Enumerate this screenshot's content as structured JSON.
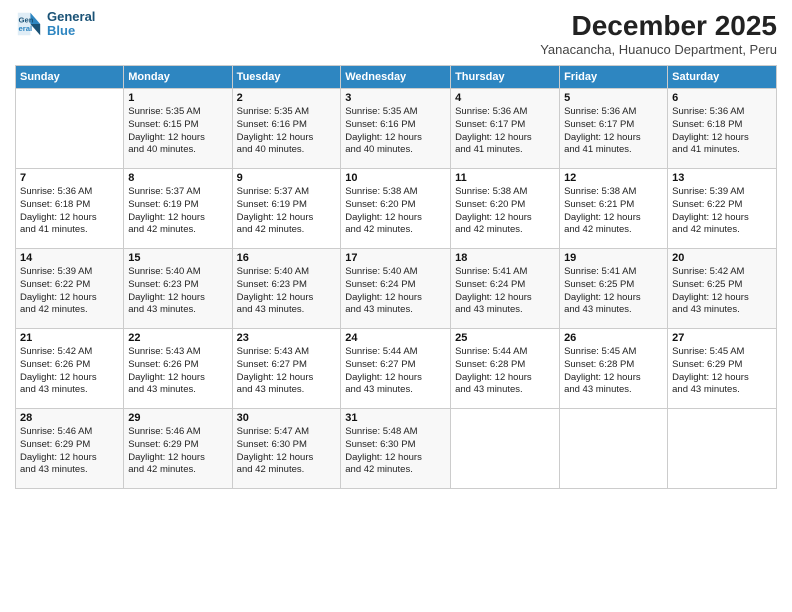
{
  "logo": {
    "line1": "General",
    "line2": "Blue"
  },
  "title": "December 2025",
  "subtitle": "Yanacancha, Huanuco Department, Peru",
  "days_of_week": [
    "Sunday",
    "Monday",
    "Tuesday",
    "Wednesday",
    "Thursday",
    "Friday",
    "Saturday"
  ],
  "weeks": [
    [
      {
        "day": "",
        "info": ""
      },
      {
        "day": "1",
        "info": "Sunrise: 5:35 AM\nSunset: 6:15 PM\nDaylight: 12 hours\nand 40 minutes."
      },
      {
        "day": "2",
        "info": "Sunrise: 5:35 AM\nSunset: 6:16 PM\nDaylight: 12 hours\nand 40 minutes."
      },
      {
        "day": "3",
        "info": "Sunrise: 5:35 AM\nSunset: 6:16 PM\nDaylight: 12 hours\nand 40 minutes."
      },
      {
        "day": "4",
        "info": "Sunrise: 5:36 AM\nSunset: 6:17 PM\nDaylight: 12 hours\nand 41 minutes."
      },
      {
        "day": "5",
        "info": "Sunrise: 5:36 AM\nSunset: 6:17 PM\nDaylight: 12 hours\nand 41 minutes."
      },
      {
        "day": "6",
        "info": "Sunrise: 5:36 AM\nSunset: 6:18 PM\nDaylight: 12 hours\nand 41 minutes."
      }
    ],
    [
      {
        "day": "7",
        "info": "Sunrise: 5:36 AM\nSunset: 6:18 PM\nDaylight: 12 hours\nand 41 minutes."
      },
      {
        "day": "8",
        "info": "Sunrise: 5:37 AM\nSunset: 6:19 PM\nDaylight: 12 hours\nand 42 minutes."
      },
      {
        "day": "9",
        "info": "Sunrise: 5:37 AM\nSunset: 6:19 PM\nDaylight: 12 hours\nand 42 minutes."
      },
      {
        "day": "10",
        "info": "Sunrise: 5:38 AM\nSunset: 6:20 PM\nDaylight: 12 hours\nand 42 minutes."
      },
      {
        "day": "11",
        "info": "Sunrise: 5:38 AM\nSunset: 6:20 PM\nDaylight: 12 hours\nand 42 minutes."
      },
      {
        "day": "12",
        "info": "Sunrise: 5:38 AM\nSunset: 6:21 PM\nDaylight: 12 hours\nand 42 minutes."
      },
      {
        "day": "13",
        "info": "Sunrise: 5:39 AM\nSunset: 6:22 PM\nDaylight: 12 hours\nand 42 minutes."
      }
    ],
    [
      {
        "day": "14",
        "info": "Sunrise: 5:39 AM\nSunset: 6:22 PM\nDaylight: 12 hours\nand 42 minutes."
      },
      {
        "day": "15",
        "info": "Sunrise: 5:40 AM\nSunset: 6:23 PM\nDaylight: 12 hours\nand 43 minutes."
      },
      {
        "day": "16",
        "info": "Sunrise: 5:40 AM\nSunset: 6:23 PM\nDaylight: 12 hours\nand 43 minutes."
      },
      {
        "day": "17",
        "info": "Sunrise: 5:40 AM\nSunset: 6:24 PM\nDaylight: 12 hours\nand 43 minutes."
      },
      {
        "day": "18",
        "info": "Sunrise: 5:41 AM\nSunset: 6:24 PM\nDaylight: 12 hours\nand 43 minutes."
      },
      {
        "day": "19",
        "info": "Sunrise: 5:41 AM\nSunset: 6:25 PM\nDaylight: 12 hours\nand 43 minutes."
      },
      {
        "day": "20",
        "info": "Sunrise: 5:42 AM\nSunset: 6:25 PM\nDaylight: 12 hours\nand 43 minutes."
      }
    ],
    [
      {
        "day": "21",
        "info": "Sunrise: 5:42 AM\nSunset: 6:26 PM\nDaylight: 12 hours\nand 43 minutes."
      },
      {
        "day": "22",
        "info": "Sunrise: 5:43 AM\nSunset: 6:26 PM\nDaylight: 12 hours\nand 43 minutes."
      },
      {
        "day": "23",
        "info": "Sunrise: 5:43 AM\nSunset: 6:27 PM\nDaylight: 12 hours\nand 43 minutes."
      },
      {
        "day": "24",
        "info": "Sunrise: 5:44 AM\nSunset: 6:27 PM\nDaylight: 12 hours\nand 43 minutes."
      },
      {
        "day": "25",
        "info": "Sunrise: 5:44 AM\nSunset: 6:28 PM\nDaylight: 12 hours\nand 43 minutes."
      },
      {
        "day": "26",
        "info": "Sunrise: 5:45 AM\nSunset: 6:28 PM\nDaylight: 12 hours\nand 43 minutes."
      },
      {
        "day": "27",
        "info": "Sunrise: 5:45 AM\nSunset: 6:29 PM\nDaylight: 12 hours\nand 43 minutes."
      }
    ],
    [
      {
        "day": "28",
        "info": "Sunrise: 5:46 AM\nSunset: 6:29 PM\nDaylight: 12 hours\nand 43 minutes."
      },
      {
        "day": "29",
        "info": "Sunrise: 5:46 AM\nSunset: 6:29 PM\nDaylight: 12 hours\nand 42 minutes."
      },
      {
        "day": "30",
        "info": "Sunrise: 5:47 AM\nSunset: 6:30 PM\nDaylight: 12 hours\nand 42 minutes."
      },
      {
        "day": "31",
        "info": "Sunrise: 5:48 AM\nSunset: 6:30 PM\nDaylight: 12 hours\nand 42 minutes."
      },
      {
        "day": "",
        "info": ""
      },
      {
        "day": "",
        "info": ""
      },
      {
        "day": "",
        "info": ""
      }
    ]
  ]
}
